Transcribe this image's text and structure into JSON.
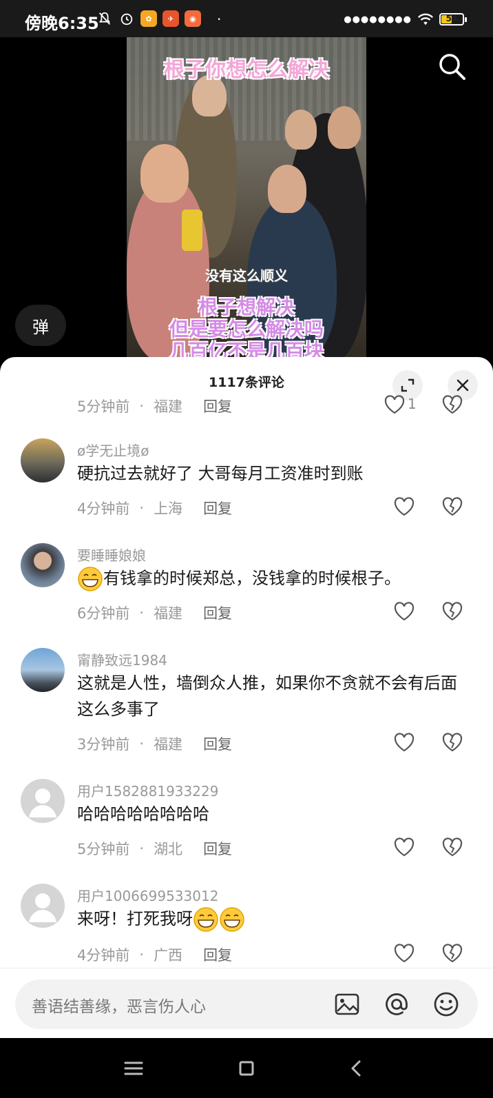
{
  "status_bar": {
    "time": "傍晚6:35",
    "battery": "54",
    "battery_level": 0.54
  },
  "video": {
    "caption_top": "根子你想怎么解决",
    "caption_mid": "没有这么顺义",
    "caption_bottom_line1": "根子想解决",
    "caption_bottom_line2": "但是要怎么解决吗",
    "caption_bottom_line3": "几百亿不是几百块",
    "danmu_label": "弹"
  },
  "panel": {
    "title": "1117条评论"
  },
  "first_meta": {
    "time": "5分钟前",
    "location": "福建",
    "reply": "回复",
    "likes": "1"
  },
  "comments": [
    {
      "username": "ø学无止境ø",
      "text": "硬抗过去就好了  大哥每月工资准时到账",
      "time": "4分钟前",
      "location": "上海",
      "reply": "回复"
    },
    {
      "username": "要睡睡娘娘",
      "text": "有钱拿的时候郑总，没钱拿的时候根子。",
      "time": "6分钟前",
      "location": "福建",
      "reply": "回复"
    },
    {
      "username": "甯静致远1984",
      "text": "这就是人性，墙倒众人推，如果你不贪就不会有后面这么多事了",
      "time": "3分钟前",
      "location": "福建",
      "reply": "回复"
    },
    {
      "username": "用户1582881933229",
      "text": "哈哈哈哈哈哈哈哈",
      "time": "5分钟前",
      "location": "湖北",
      "reply": "回复"
    },
    {
      "username": "用户1006699533012",
      "text": "来呀！打死我呀",
      "time": "4分钟前",
      "location": "广西",
      "reply": "回复"
    }
  ],
  "input": {
    "placeholder": "善语结善缘，恶言伤人心"
  },
  "colors": {
    "panel_bg": "#ffffff",
    "meta_text": "#999999",
    "caption_pink": "#f3a6d8",
    "caption_purple": "#d58be6",
    "battery": "#f5c518"
  }
}
